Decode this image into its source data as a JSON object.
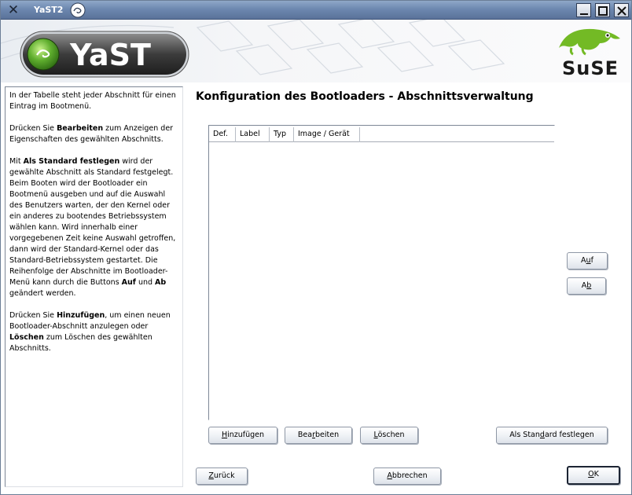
{
  "window": {
    "title": "YaST2"
  },
  "banner": {
    "yast_logo_text": "YaST",
    "vendor_logo_text": "SuSE"
  },
  "help": {
    "paragraphs": [
      {
        "text": "In der Tabelle steht jeder Abschnitt für einen Eintrag im Bootmenü."
      },
      {
        "pre": "Drücken Sie ",
        "bold": "Bearbeiten",
        "post": " zum Anzeigen der Eigenschaften des gewählten Abschnitts."
      },
      {
        "pre": "Mit ",
        "bold": "Als Standard festlegen",
        "post": " wird der gewählte Abschnitt als Standard festgelegt. Beim Booten wird der Bootloader ein Bootmenü ausgeben und auf die Auswahl des Benutzers warten, der den Kernel oder ein anderes zu bootendes Betriebssystem wählen kann. Wird innerhalb einer vorgegebenen Zeit keine Auswahl getroffen, dann wird der Standard-Kernel oder das Standard-Betriebssystem gestartet. Die Reihenfolge der Abschnitte im Bootloader-Menü kann durch die Buttons ",
        "bold2": "Auf",
        "mid2": " und ",
        "bold3": "Ab",
        "post2": " geändert werden."
      },
      {
        "pre": "Drücken Sie ",
        "bold": "Hinzufügen",
        "post": ", um einen neuen Bootloader-Abschnitt anzulegen oder ",
        "bold2": "Löschen",
        "post2": " zum Löschen des gewählten Abschnitts."
      }
    ]
  },
  "main": {
    "title": "Konfiguration des Bootloaders - Abschnittsverwaltung",
    "table": {
      "columns": [
        "Def.",
        "Label",
        "Typ",
        "Image / Gerät"
      ],
      "rows": []
    },
    "buttons": {
      "up": {
        "label_pre": "A",
        "label_u": "u",
        "label_post": "f"
      },
      "down": {
        "label_pre": "A",
        "label_u": "b",
        "label_post": ""
      },
      "add": {
        "label_pre": "",
        "label_u": "H",
        "label_post": "inzufügen"
      },
      "edit": {
        "label_pre": "Bea",
        "label_u": "r",
        "label_post": "beiten"
      },
      "delete": {
        "label_pre": "",
        "label_u": "L",
        "label_post": "öschen"
      },
      "set_default": {
        "label_pre": "Als Stan",
        "label_u": "d",
        "label_post": "ard festlegen"
      }
    }
  },
  "footer": {
    "back": {
      "label_pre": "",
      "label_u": "Z",
      "label_post": "urück"
    },
    "abort": {
      "label_pre": "",
      "label_u": "A",
      "label_post": "bbrechen"
    },
    "ok": {
      "label_pre": "",
      "label_u": "O",
      "label_post": "K"
    }
  },
  "colors": {
    "titlebar": "#6d88b0",
    "yast_green": "#5fae2e",
    "suse_green": "#73ba25"
  }
}
